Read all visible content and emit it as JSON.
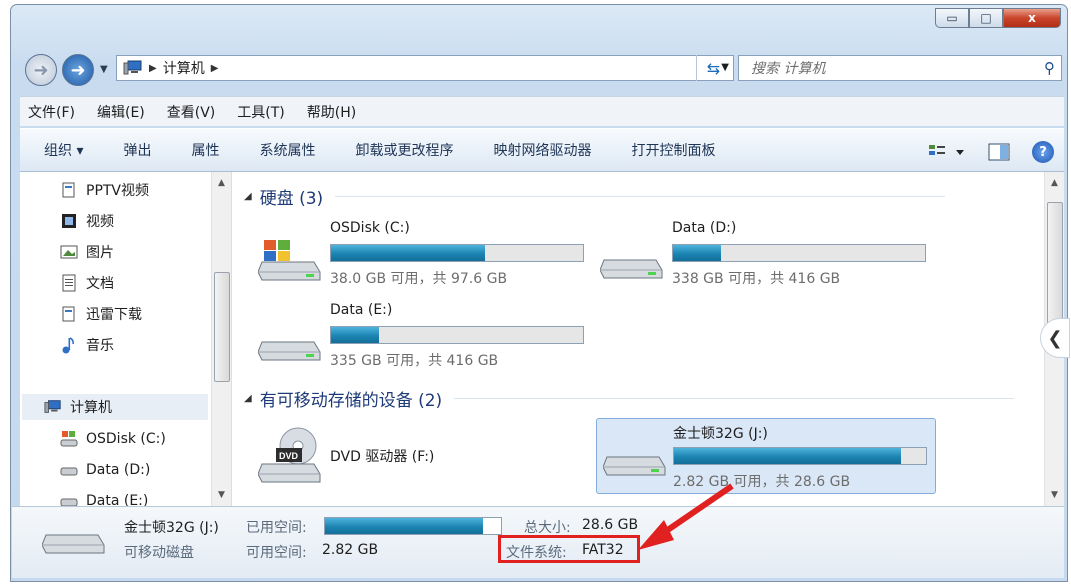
{
  "window": {
    "buttons": {
      "minimize": "▭",
      "maximize": "□",
      "close": "x"
    }
  },
  "nav": {
    "address_segments": [
      "计算机"
    ],
    "search_placeholder": "搜索 计算机"
  },
  "menu": [
    "文件(F)",
    "编辑(E)",
    "查看(V)",
    "工具(T)",
    "帮助(H)"
  ],
  "commands": [
    "组织 ▾",
    "弹出",
    "属性",
    "系统属性",
    "卸载或更改程序",
    "映射网络驱动器",
    "打开控制面板"
  ],
  "sidebar": {
    "items": [
      {
        "label": "PPTV视频",
        "icon": "library-icon"
      },
      {
        "label": "视频",
        "icon": "video-icon"
      },
      {
        "label": "图片",
        "icon": "picture-icon"
      },
      {
        "label": "文档",
        "icon": "document-icon"
      },
      {
        "label": "迅雷下载",
        "icon": "library-icon"
      },
      {
        "label": "音乐",
        "icon": "music-icon"
      }
    ],
    "computer": "计算机",
    "drives": [
      {
        "label": "OSDisk (C:)",
        "icon": "windows-drive-icon"
      },
      {
        "label": "Data (D:)",
        "icon": "drive-icon"
      },
      {
        "label": "Data (E:)",
        "icon": "drive-icon"
      }
    ]
  },
  "groups": {
    "hard_disks": "硬盘 (3)",
    "removable": "有可移动存储的设备 (2)"
  },
  "drives": [
    {
      "name": "OSDisk (C:)",
      "info": "38.0 GB 可用，共 97.6 GB",
      "used_fraction": 0.61
    },
    {
      "name": "Data (D:)",
      "info": "338 GB 可用，共 416 GB",
      "used_fraction": 0.19
    },
    {
      "name": "Data (E:)",
      "info": "335 GB 可用，共 416 GB",
      "used_fraction": 0.19
    }
  ],
  "dvd": {
    "name": "DVD 驱动器 (F:)",
    "badge": "DVD"
  },
  "usb": {
    "name": "金士顿32G (J:)",
    "info": "2.82 GB 可用，共 28.6 GB",
    "used_fraction": 0.9
  },
  "details": {
    "name": "金士顿32G (J:)",
    "type": "可移动磁盘",
    "used_label": "已用空间:",
    "free_label": "可用空间:",
    "free_value": "2.82 GB",
    "total_label": "总大小:",
    "total_value": "28.6 GB",
    "fs_label": "文件系统:",
    "fs_value": "FAT32",
    "used_fraction": 0.9
  }
}
